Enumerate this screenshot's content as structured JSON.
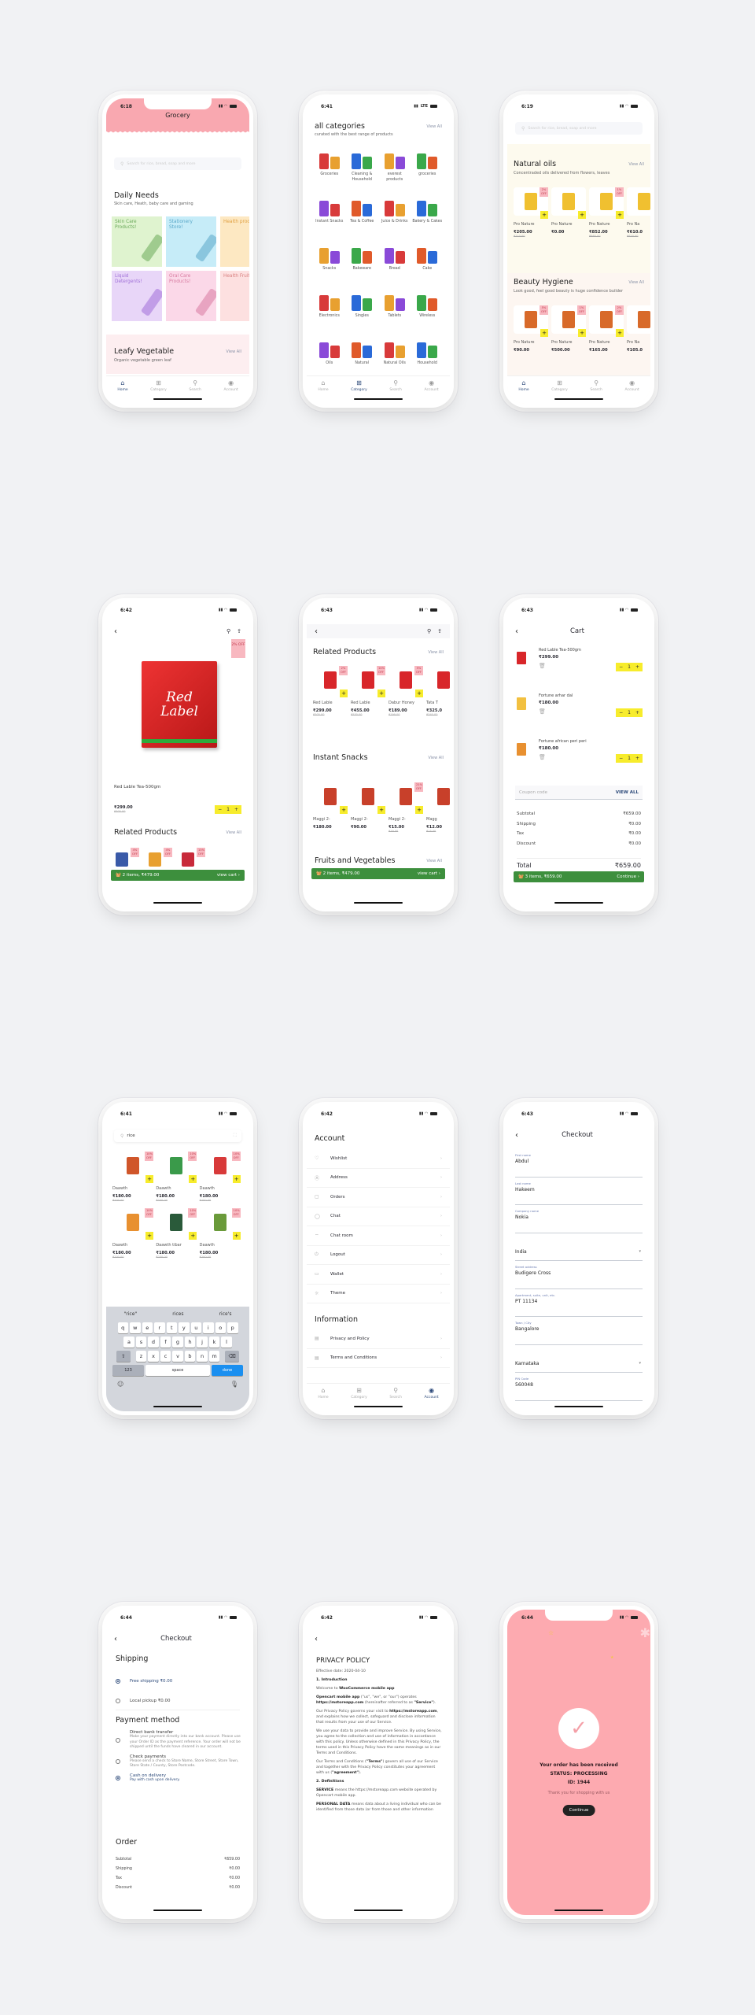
{
  "colors": {
    "pink": "#f9a8b0",
    "green": "#3d8f3d",
    "yellow": "#f7ec2c",
    "navy": "#2d4a7a",
    "badge": "#f8b8c0"
  },
  "tabbar": [
    {
      "label": "Home",
      "icon": "home-icon"
    },
    {
      "label": "Category",
      "icon": "grid-icon"
    },
    {
      "label": "Search",
      "icon": "search-icon"
    },
    {
      "label": "Account",
      "icon": "account-icon"
    }
  ],
  "home": {
    "time": "6:18",
    "title": "Grocery",
    "search_placeholder": "Search for rice, bread, soap and more",
    "section_title": "Daily Needs",
    "section_sub": "Skin care, Heath, baby care and gaming",
    "tiles": [
      {
        "label": "Skin Care Products!",
        "bg": "#dff3cf",
        "fg": "#6aaa5a"
      },
      {
        "label": "Stationery Store!",
        "bg": "#c6ecf8",
        "fg": "#5aa8c8"
      },
      {
        "label": "Health produc",
        "bg": "#fde8c2",
        "fg": "#e0a040"
      },
      {
        "label": "Liquid Detergents!",
        "bg": "#e8d6f8",
        "fg": "#a070d8"
      },
      {
        "label": "Oral Care Products!",
        "bg": "#fbd8e8",
        "fg": "#d87aa0"
      },
      {
        "label": "Health Fruits!",
        "bg": "#fde0e0",
        "fg": "#d88080"
      }
    ],
    "leafy_title": "Leafy Vegetable",
    "leafy_sub": "Organic vegetable green leaf",
    "view_all": "View All"
  },
  "categories": {
    "time": "6:41",
    "network": "LTE",
    "title": "all categories",
    "sub": "curated with the best range of products",
    "view_all": "View All",
    "items": [
      "Groceries",
      "Cleaning & Household",
      "everest products",
      "groceries",
      "Instant Snacks",
      "Tea & Coffee",
      "Juice & Drinks",
      "Bakery & Cakes",
      "Snacks",
      "Bakeware",
      "Bread",
      "Cake",
      "Electronics",
      "Singles",
      "Tablets",
      "Wireless",
      "Oils",
      "Natural",
      "Natural Oils",
      "Household"
    ]
  },
  "home2": {
    "time": "6:19",
    "search_placeholder": "Search for rice, bread, soap and more",
    "sections": [
      {
        "title": "Natural oils",
        "sub": "Concentraded oils delivered from flowers, leaves",
        "view_all": "View All",
        "products": [
          {
            "name": "Pro Nature",
            "price": "₹205.00",
            "old": "₹210.00",
            "off": "2% OFF"
          },
          {
            "name": "Pro Nature",
            "price": "₹0.00",
            "old": "",
            "off": ""
          },
          {
            "name": "Pro Nature",
            "price": "₹852.00",
            "old": "₹860.00",
            "off": "1% OFF"
          },
          {
            "name": "Pro Na",
            "price": "₹610.0",
            "old": "₹620.00",
            "off": ""
          }
        ]
      },
      {
        "title": "Beauty Hygiene",
        "sub": "Look good, feel good beauty is huge confidence builder",
        "view_all": "View All",
        "products": [
          {
            "name": "Pro Nature",
            "price": "₹90.00",
            "old": "",
            "off": "5% OFF"
          },
          {
            "name": "Pro Nature",
            "price": "₹500.00",
            "old": "",
            "off": "1% OFF"
          },
          {
            "name": "Pro Nature",
            "price": "₹165.00",
            "old": "",
            "off": "2% OFF"
          },
          {
            "name": "Pro Na",
            "price": "₹105.0",
            "old": "",
            "off": ""
          }
        ]
      }
    ]
  },
  "product": {
    "time": "6:42",
    "off": "2% OFF",
    "brand_line1": "Red",
    "brand_line2": "Label",
    "name": "Red Lable Tea-500gm",
    "price": "₹299.00",
    "old": "₹305.00",
    "qty": "1",
    "related_title": "Related Products",
    "view_all": "View All",
    "related_offs": [
      "4% OFF",
      "4% OFF",
      "13% OFF"
    ],
    "cart_bar": "2 items, ₹479.00",
    "cart_action": "view cart ›"
  },
  "product2": {
    "time": "6:43",
    "sections": [
      {
        "title": "Related Products",
        "view_all": "View All",
        "products": [
          {
            "name": "Red Lable",
            "price": "₹299.00",
            "old": "₹305.00",
            "off": "2% OFF"
          },
          {
            "name": "Red Lable",
            "price": "₹455.00",
            "old": "₹530.00",
            "off": "14% OFF"
          },
          {
            "name": "Dabur Honey",
            "price": "₹189.00",
            "old": "₹199.00",
            "off": "5% OFF"
          },
          {
            "name": "Tata T",
            "price": "₹325.0",
            "old": "₹340.00",
            "off": ""
          }
        ]
      },
      {
        "title": "Instant Snacks",
        "view_all": "View All",
        "products": [
          {
            "name": "Maggi 2-",
            "price": "₹180.00",
            "old": "",
            "off": ""
          },
          {
            "name": "Maggi 2-",
            "price": "₹90.00",
            "old": "",
            "off": ""
          },
          {
            "name": "Maggi 2-",
            "price": "₹15.00",
            "old": "₹19.00",
            "off": "21% OFF"
          },
          {
            "name": "Magg",
            "price": "₹12.00",
            "old": "₹15.00",
            "off": ""
          }
        ]
      }
    ],
    "fruits_title": "Fruits and Vegetables",
    "view_all": "View All",
    "cart_bar": "2 items, ₹479.00",
    "cart_action": "view cart ›"
  },
  "cart": {
    "time": "6:43",
    "title": "Cart",
    "items": [
      {
        "name": "Red Lable Tea-500gm",
        "price": "₹299.00",
        "qty": "1",
        "color": "#d8262a"
      },
      {
        "name": "Fortune arhar dal",
        "price": "₹180.00",
        "qty": "1",
        "color": "#f2c040"
      },
      {
        "name": "Fortune african peri peri",
        "price": "₹180.00",
        "qty": "1",
        "color": "#e89030"
      }
    ],
    "coupon_placeholder": "Coupon code",
    "coupon_action": "VIEW ALL",
    "summary": [
      {
        "label": "Subtotal",
        "value": "₹659.00"
      },
      {
        "label": "Shipping",
        "value": "₹0.00"
      },
      {
        "label": "Tax",
        "value": "₹0.00"
      },
      {
        "label": "Discount",
        "value": "₹0.00"
      }
    ],
    "total_label": "Total",
    "total_value": "₹659.00",
    "bar": "3 items, ₹659.00",
    "bar_action": "Continue ›"
  },
  "search": {
    "time": "6:41",
    "query": "rice",
    "products": [
      {
        "name": "Daawth",
        "price": "₹180.00",
        "old": "₹200.00",
        "off": "10% OFF",
        "color": "#d0562a"
      },
      {
        "name": "Daawth",
        "price": "₹180.00",
        "old": "₹200.00",
        "off": "10% OFF",
        "color": "#3a9a4a"
      },
      {
        "name": "Daawth",
        "price": "₹180.00",
        "old": "₹200.00",
        "off": "10% OFF",
        "color": "#d83a3a"
      },
      {
        "name": "Daawth",
        "price": "₹180.00",
        "old": "₹200.00",
        "off": "10% OFF",
        "color": "#e89030"
      },
      {
        "name": "Daawth tibar",
        "price": "₹180.00",
        "old": "₹200.00",
        "off": "10% OFF",
        "color": "#2a5a3a"
      },
      {
        "name": "Daawth",
        "price": "₹180.00",
        "old": "₹200.00",
        "off": "10% OFF",
        "color": "#6a9a3a"
      }
    ],
    "suggestions": [
      "\"rice\"",
      "rices",
      "rice's"
    ],
    "keys_row1": [
      "q",
      "w",
      "e",
      "r",
      "t",
      "y",
      "u",
      "i",
      "o",
      "p"
    ],
    "keys_row2": [
      "a",
      "s",
      "d",
      "f",
      "g",
      "h",
      "j",
      "k",
      "l"
    ],
    "keys_row3": [
      "z",
      "x",
      "c",
      "v",
      "b",
      "n",
      "m"
    ],
    "key_123": "123",
    "key_space": "space",
    "key_done": "done"
  },
  "account": {
    "time": "6:42",
    "title": "Account",
    "items": [
      {
        "label": "Wishlist",
        "icon": "♡",
        "name": "heart-icon"
      },
      {
        "label": "Address",
        "icon": "Ⓐ",
        "name": "address-icon"
      },
      {
        "label": "Orders",
        "icon": "▢",
        "name": "bag-icon"
      },
      {
        "label": "Chat",
        "icon": "◯",
        "name": "chat-icon"
      },
      {
        "label": "Chat room",
        "icon": "⌔",
        "name": "chat-room-icon"
      },
      {
        "label": "Logout",
        "icon": "⏻",
        "name": "power-icon"
      },
      {
        "label": "Wallet",
        "icon": "▭",
        "name": "wallet-icon"
      },
      {
        "label": "Theme",
        "icon": "☼",
        "name": "sun-icon"
      }
    ],
    "info_title": "Information",
    "info_items": [
      {
        "label": "Privacy and Policy",
        "icon": "▤",
        "name": "document-icon"
      },
      {
        "label": "Terms and Conditions",
        "icon": "▤",
        "name": "document-icon"
      }
    ]
  },
  "checkout1": {
    "time": "6:43",
    "title": "Checkout",
    "fields": [
      {
        "label": "First name",
        "value": "Abdul"
      },
      {
        "label": "Last name",
        "value": "Hakeem"
      },
      {
        "label": "Company name",
        "value": "Nokia"
      },
      {
        "label": "",
        "value": "India",
        "select": true
      },
      {
        "label": "Street address",
        "value": "Budigere Cross"
      },
      {
        "label": "Apartment, suite, unit, etc.",
        "value": "PT 11134"
      },
      {
        "label": "Town / City",
        "value": "Bangalore"
      },
      {
        "label": "",
        "value": "Karnataka",
        "select": true
      },
      {
        "label": "PIN Code",
        "value": "560048"
      }
    ]
  },
  "checkout2": {
    "time": "6:44",
    "title": "Checkout",
    "shipping_title": "Shipping",
    "shipping": [
      {
        "label": "Free shipping ₹0.00",
        "selected": true
      },
      {
        "label": "Local pickup ₹0.00",
        "selected": false
      }
    ],
    "payment_title": "Payment method",
    "payments": [
      {
        "title": "Direct bank transfer",
        "desc": "Make your payment directly into our bank account. Please use your Order ID as the payment reference. Your order will not be shipped until the funds have cleared in our account.",
        "selected": false
      },
      {
        "title": "Check payments",
        "desc": "Please send a check to Store Name, Store Street, Store Town, Store State / County, Store Postcode.",
        "selected": false
      },
      {
        "title": "Cash on delivery",
        "desc": "Pay with cash upon delivery.",
        "selected": true
      }
    ],
    "order_title": "Order",
    "summary": [
      {
        "label": "Subtotal",
        "value": "₹659.00"
      },
      {
        "label": "Shipping",
        "value": "₹0.00"
      },
      {
        "label": "Tax",
        "value": "₹0.00"
      },
      {
        "label": "Discount",
        "value": "₹0.00"
      }
    ]
  },
  "privacy": {
    "time": "6:42",
    "title": "PRIVACY POLICY",
    "effective": "Effective date: 2020-04-10",
    "intro": "1. Introduction",
    "p1a": "Welcome to ",
    "p1b": "WooCommerce mobile app",
    "p2a": "Opencart mobile app",
    "p2b": " (\"us\", \"we\", or \"our\") operates ",
    "p2c": "https://mstoreapp.com",
    "p2d": " (hereinafter referred to as ",
    "p2e": "\"Service\"",
    "p3a": "Our Privacy Policy governs your visit to ",
    "p3b": "https://mstoreapp.com",
    "p3c": ", and explains how we collect, safeguard and disclose information that results from your use of our Service.",
    "p4": "We use your data to provide and improve Service. By using Service, you agree to the collection and use of information in accordance with this policy. Unless otherwise defined in this Privacy Policy, the terms used in this Privacy Policy have the same meanings as in our Terms and Conditions.",
    "p5a": "Our Terms and Conditions (",
    "p5b": "\"Terms\"",
    "p5c": ") govern all use of our Service and together with the Privacy Policy constitutes your agreement with us (",
    "p5d": "\"agreement\"",
    "p5e": ").",
    "defs": "2. Definitions",
    "p6a": "SERVICE",
    "p6b": " means the https://mstoreapp.com website operated by Opencart mobile app.",
    "p7a": "PERSONAL DATA",
    "p7b": " means data about a living individual who can be identified from those data (or from those and other information"
  },
  "success": {
    "time": "6:44",
    "line1": "Your order has been received",
    "line2": "STATUS: PROCESSING",
    "line3": "ID: 1944",
    "thanks": "Thank you for shopping with us",
    "button": "Continue"
  }
}
